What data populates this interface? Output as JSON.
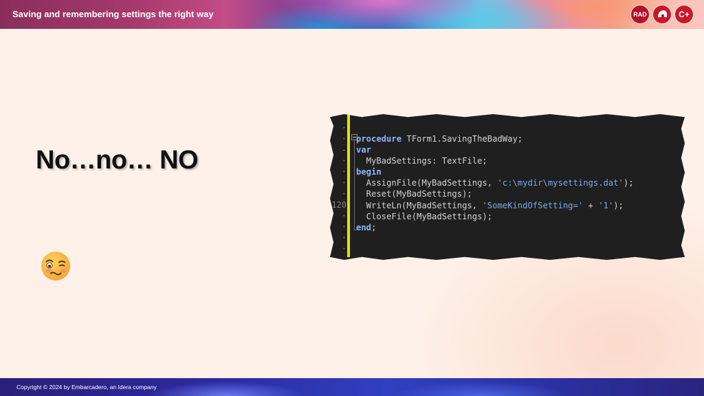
{
  "header": {
    "title": "Saving and remembering settings the right way",
    "logos": [
      {
        "label": "RAD",
        "icon": "rad-studio-logo-icon"
      },
      {
        "label": "",
        "icon": "delphi-helmet-logo-icon"
      },
      {
        "label": "C+",
        "icon": "cpp-builder-logo-icon"
      }
    ]
  },
  "slide": {
    "heading": "No…no… NO",
    "emoji": "woozy-face-emoji"
  },
  "code_panel": {
    "gutter_marker": "120",
    "lines": [
      {
        "kw": "procedure",
        "rest": " TForm1.SavingTheBadWay;"
      },
      {
        "kw": "var",
        "rest": ""
      },
      {
        "kw": "",
        "rest": "  MyBadSettings: TextFile;"
      },
      {
        "kw": "begin",
        "rest": ""
      },
      {
        "kw": "",
        "pre": "  AssignFile(MyBadSettings, ",
        "str": "'c:\\mydir\\mysettings.dat'",
        "post": ");"
      },
      {
        "kw": "",
        "rest": "  Reset(MyBadSettings);"
      },
      {
        "kw": "",
        "pre": "  WriteLn(MyBadSettings, ",
        "str": "'SomeKindOfSetting='",
        "mid": " + ",
        "str2": "'1'",
        "post": ");"
      },
      {
        "kw": "",
        "rest": "  CloseFile(MyBadSettings);"
      },
      {
        "kw": "end",
        "rest": ";"
      }
    ]
  },
  "footer": {
    "copyright": "Copyright © 2024  by Embarcadero, an Idera company"
  }
}
